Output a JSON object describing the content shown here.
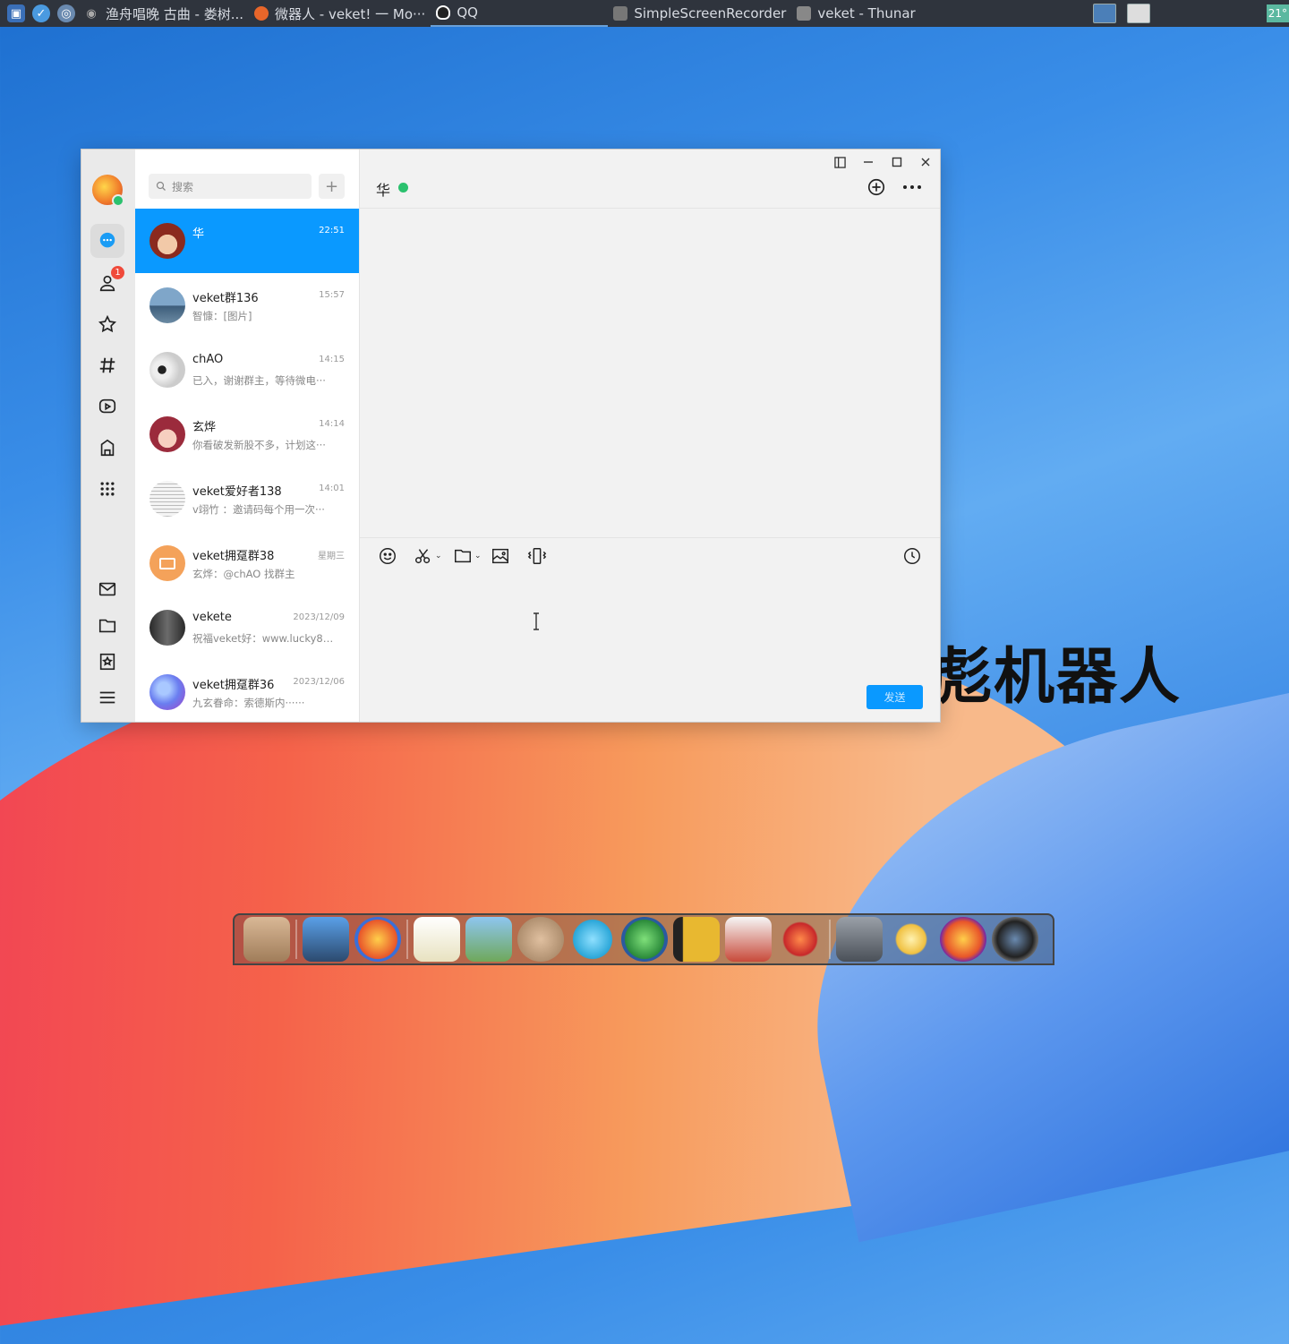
{
  "topbar": {
    "tasks": [
      {
        "label": "渔舟唱晚 古曲 - 娄树..."
      },
      {
        "label": "微器人 - veket! 一 Mo···"
      },
      {
        "label": "QQ"
      },
      {
        "label": "SimpleScreenRecorder"
      },
      {
        "label": "veket - Thunar"
      }
    ],
    "clock": "21°"
  },
  "wallpaper": {
    "text": "彪机器人"
  },
  "sidebar": {
    "icons": [
      "app-logo",
      "chat-icon",
      "contacts-icon",
      "star-icon",
      "hash-icon",
      "video-icon",
      "game-icon",
      "apps-grid-icon",
      "mail-icon",
      "folder-icon",
      "bookmark-icon",
      "menu-icon"
    ],
    "contacts_badge": "1"
  },
  "search": {
    "placeholder": "搜索"
  },
  "conversations": [
    {
      "name": "华",
      "time": "22:51",
      "message": "",
      "avatar_color": "#c0392b"
    },
    {
      "name": "veket群136",
      "time": "15:57",
      "message": "智慷：[图片]",
      "avatar_color": "#5a86b0"
    },
    {
      "name": "chAO",
      "time": "14:15",
      "message": "已入，谢谢群主，等待微电···",
      "avatar_color": "#dcdcdc"
    },
    {
      "name": "玄烨",
      "time": "14:14",
      "message": "你看破发新股不多，计划这···",
      "avatar_color": "#9b2b3c"
    },
    {
      "name": "veket爱好者138",
      "time": "14:01",
      "message": "v翊竹 ：邀请码每个用一次···",
      "avatar_color": "#e8e8e8"
    },
    {
      "name": "veket拥趸群38",
      "time": "星期三",
      "message": "玄烨：@chAO 找群主",
      "avatar_color": "#f4a25a"
    },
    {
      "name": "vekete",
      "time": "2023/12/09",
      "message": "祝福veket好：www.lucky8k.···",
      "avatar_color": "#3a3a3a"
    },
    {
      "name": "veket拥趸群36",
      "time": "2023/12/06",
      "message": "九玄眷命：索德斯内······",
      "avatar_color": "#6a7ef0"
    }
  ],
  "chat": {
    "title": "华",
    "send_label": "发送"
  },
  "colors": {
    "accent": "#0a99ff",
    "online": "#2bc16e"
  }
}
